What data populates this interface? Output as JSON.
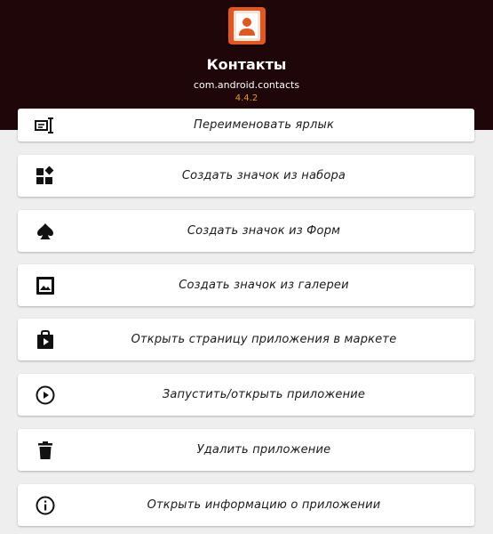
{
  "app": {
    "title": "Контакты",
    "package": "com.android.contacts",
    "version": "4.4.2",
    "icon": "contacts-app-icon"
  },
  "colors": {
    "header_bg": "#1e0609",
    "version": "#e59c1c",
    "app_icon": "#e2561f",
    "icon": "#111111"
  },
  "menu": {
    "items": [
      {
        "label": "Переименовать ярлык",
        "icon": "rename-icon"
      },
      {
        "label": "Создать значок из набора",
        "icon": "icon-set-icon"
      },
      {
        "label": "Создать значок из Форм",
        "icon": "shape-icon"
      },
      {
        "label": "Создать значок из галереи",
        "icon": "gallery-icon"
      },
      {
        "label": "Открыть страницу приложения в маркете",
        "icon": "market-icon"
      },
      {
        "label": "Запустить/открыть приложение",
        "icon": "play-icon"
      },
      {
        "label": "Удалить приложение",
        "icon": "delete-icon"
      },
      {
        "label": "Открыть информацию о приложении",
        "icon": "info-icon"
      }
    ]
  }
}
